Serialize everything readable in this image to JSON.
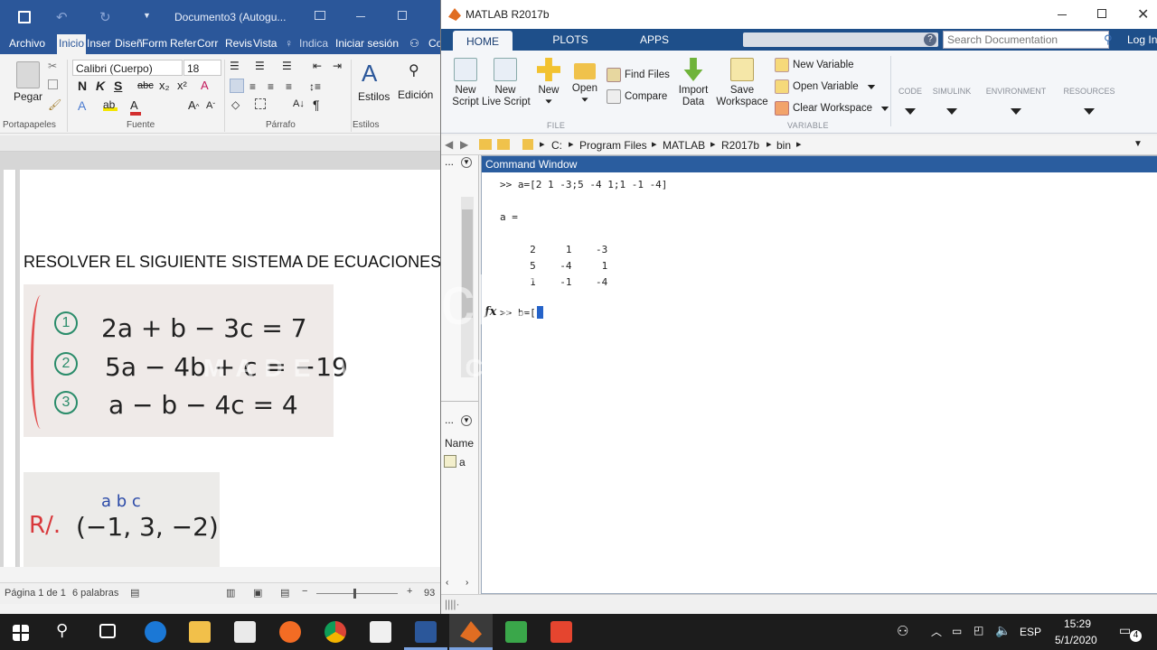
{
  "word": {
    "doc_title": "Documento3 (Autogu...",
    "tabs": [
      "Archivo",
      "Inicio",
      "Inser",
      "Diseñ",
      "Form",
      "Refer",
      "Corr",
      "Revis",
      "Vista"
    ],
    "tell_me": "Indica",
    "sign_in": "Iniciar sesión",
    "share": "Co",
    "font_name": "Calibri (Cuerpo)",
    "font_size": "18",
    "paste_label": "Pegar",
    "styles_label": "Estilos",
    "editing_label": "Edición",
    "groups": [
      "Portapapeles",
      "Fuente",
      "Párrafo",
      "Estilos"
    ],
    "heading": "RESOLVER EL SIGUIENTE SISTEMA DE ECUACIONES",
    "equations": [
      {
        "num": "1",
        "text": "2a + b − 3c = 7"
      },
      {
        "num": "2",
        "text": "5a − 4b + c = −19"
      },
      {
        "num": "3",
        "text": "a − b − 4c = 4"
      }
    ],
    "answer": {
      "prefix": "R/.",
      "vars": "a   b   c",
      "values": "(−1, 3, −2)"
    },
    "status": {
      "page": "Página 1 de 1",
      "words": "6 palabras",
      "zoom": "93"
    }
  },
  "matlab": {
    "window_title": "MATLAB R2017b",
    "tabs": [
      "HOME",
      "PLOTS",
      "APPS"
    ],
    "search_placeholder": "Search Documentation",
    "login": "Log In",
    "buttons": {
      "new_script": "New\nScript",
      "new_live_script": "New\nLive Script",
      "new": "New",
      "open": "Open",
      "find_files": "Find Files",
      "compare": "Compare",
      "import_data": "Import\nData",
      "save_workspace": "Save\nWorkspace",
      "new_variable": "New Variable",
      "open_variable": "Open Variable",
      "clear_workspace": "Clear Workspace"
    },
    "sections": {
      "file": "FILE",
      "variable": "VARIABLE",
      "code": "CODE",
      "simulink": "SIMULINK",
      "environment": "ENVIRONMENT",
      "resources": "RESOURCES"
    },
    "path": [
      "C:",
      "Program Files",
      "MATLAB",
      "R2017b",
      "bin"
    ],
    "command_window_title": "Command Window",
    "command_lines": [
      ">> a=[2 1 -3;5 -4 1;1 -1 -4]",
      "",
      "a =",
      "",
      "     2     1    -3",
      "     5    -4     1",
      "     1    -1    -4"
    ],
    "prompt": ">> b=[]",
    "workspace": {
      "header": "Name",
      "vars": [
        "a"
      ]
    }
  },
  "watermark": {
    "line1": "TechSmith",
    "line2": "MADE WITH CAMTASIA FREE TRIAL"
  },
  "taskbar": {
    "time": "15:29",
    "date": "5/1/2020",
    "lang": "ESP",
    "notifications": "4"
  }
}
